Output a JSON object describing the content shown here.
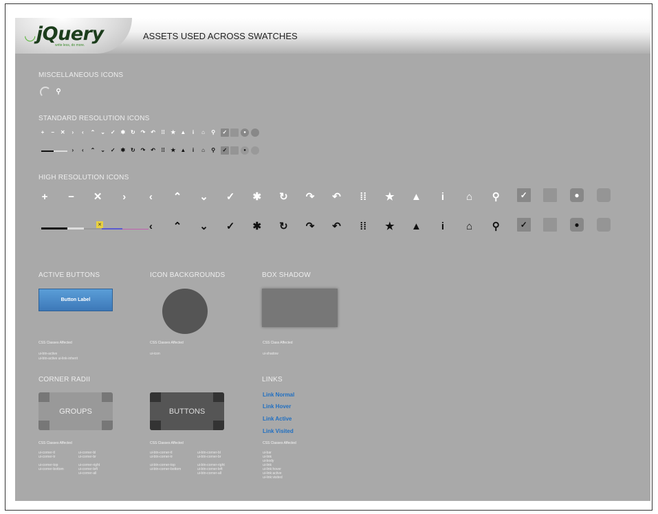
{
  "header": {
    "logo_text": "jQuery",
    "logo_subtitle": "write less, do more.",
    "title": "ASSETS USED ACROSS SWATCHES"
  },
  "sections": {
    "misc": "MISCELLANEOUS ICONS",
    "standard": "STANDARD RESOLUTION ICONS",
    "high": "HIGH RESOLUTION ICONS",
    "active_buttons": "ACTIVE BUTTONS",
    "icon_backgrounds": "ICON BACKGROUNDS",
    "box_shadow": "BOX SHADOW",
    "corner_radii": "CORNER RADII",
    "links": "LINKS"
  },
  "misc_icons": [
    "loading-spinner-icon",
    "search-icon"
  ],
  "icon_glyphs": {
    "plus": "+",
    "minus": "−",
    "delete": "✕",
    "arrow-r": "›",
    "arrow-l": "‹",
    "arrow-u": "⌃",
    "arrow-d": "⌄",
    "check": "✓",
    "gear": "✱",
    "refresh": "↻",
    "forward": "↷",
    "back": "↶",
    "grid": "⁞⁞",
    "star": "★",
    "alert": "▲",
    "info": "i",
    "home": "⌂",
    "search": "⚲"
  },
  "active_button": {
    "label": "Button Label",
    "css_title": "CSS Classes Affected",
    "classes": [
      "ui-btn-active",
      "ui-btn-active  ui-link-inherit"
    ]
  },
  "icon_backgrounds": {
    "css_title": "CSS Classes Affected",
    "classes": [
      "ui-icon"
    ]
  },
  "box_shadow": {
    "css_title": "CSS Class Affected",
    "classes": [
      "ui-shadow"
    ]
  },
  "corners": {
    "groups_label": "GROUPS",
    "buttons_label": "BUTTONS",
    "groups_css_title": "CSS Classes Affected",
    "buttons_css_title": "CSS Classes Affected",
    "groups_col1": [
      "ui-corner-tl",
      "ui-corner-tr",
      "",
      "ui-corner-top",
      "ui-corner-bottom"
    ],
    "groups_col2": [
      "ui-corner-bl",
      "ui-corner-br",
      "",
      "ui-corner-right",
      "ui-corner-left",
      "ui-corner-all"
    ],
    "buttons_col1": [
      "ui-btn-corner-tl",
      "ui-btn-corner-tr",
      "",
      "ui-btn-corner-top",
      "ui-btn-corner-bottom"
    ],
    "buttons_col2": [
      "ui-btn-corner-bl",
      "ui-btn-corner-br",
      "",
      "ui-btn-corner-right",
      "ui-btn-corner-left",
      "ui-btn-corner-all"
    ]
  },
  "links": {
    "normal": "Link Normal",
    "hover": "Link Hover",
    "active": "Link Active",
    "visited": "Link Visited",
    "css_title": "CSS Classes Affected",
    "classes": [
      "ui-bar",
      "ui-link",
      "ui-body",
      "ui-link",
      "ui-link:hover",
      "ui-link:active",
      "ui-link:visited"
    ]
  },
  "colors": {
    "panel_bg": "#a9a9a9",
    "link_blue": "#1f6fc2",
    "button_blue": "#4a8bcb"
  }
}
